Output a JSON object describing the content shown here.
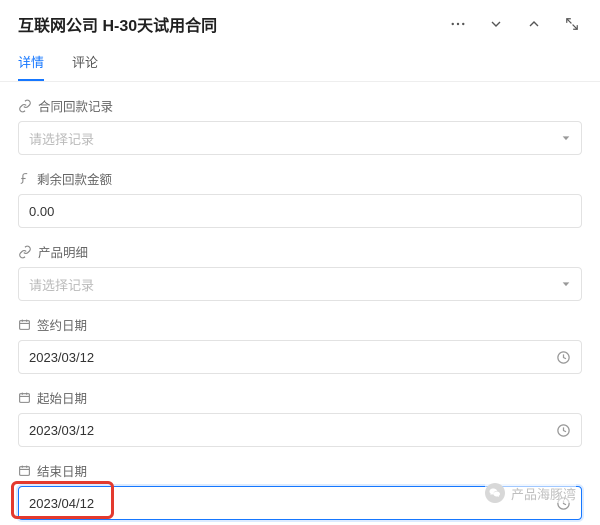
{
  "header": {
    "title": "互联网公司 H-30天试用合同"
  },
  "tabs": {
    "details": "详情",
    "comments": "评论"
  },
  "fields": {
    "repayment_record": {
      "label": "合同回款记录",
      "placeholder": "请选择记录"
    },
    "remaining_amount": {
      "label": "剩余回款金额",
      "value": "0.00"
    },
    "product_detail": {
      "label": "产品明细",
      "placeholder": "请选择记录"
    },
    "sign_date": {
      "label": "签约日期",
      "value": "2023/03/12"
    },
    "start_date": {
      "label": "起始日期",
      "value": "2023/03/12"
    },
    "end_date": {
      "label": "结束日期",
      "value": "2023/04/12"
    }
  },
  "watermark": {
    "text": "产品海豚湾"
  }
}
